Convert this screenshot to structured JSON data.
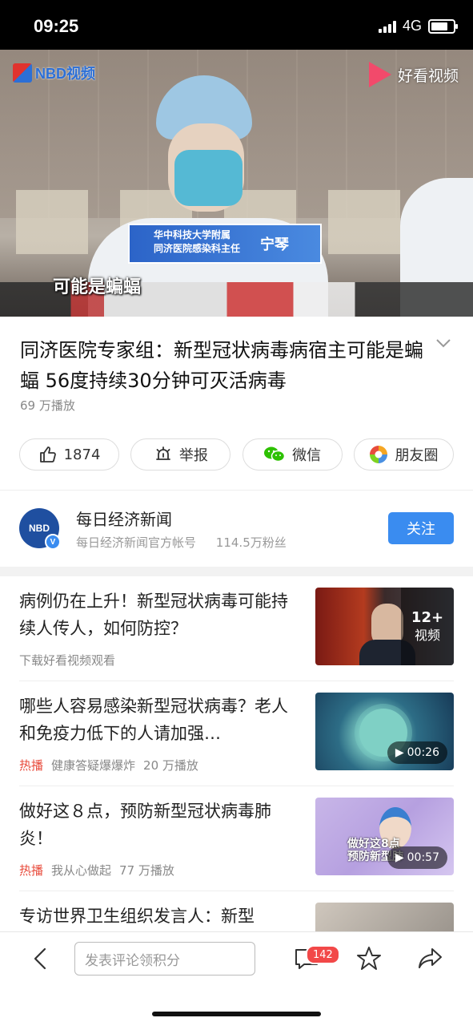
{
  "status_bar": {
    "time": "09:25",
    "network": "4G"
  },
  "video": {
    "source_logo": "NBD视频",
    "platform_logo": "好看视频",
    "caption_org_line1": "华中科技大学附属",
    "caption_org_line2": "同济医院感染科主任",
    "caption_name": "宁琴",
    "subtitle": "可能是蝙蝠"
  },
  "article": {
    "title": "同济医院专家组：新型冠状病毒病宿主可能是蝙蝠 56度持续30分钟可灭活病毒",
    "plays": "69 万播放",
    "actions": [
      {
        "label": "1874",
        "icon": "thumbs-up-icon"
      },
      {
        "label": "举报",
        "icon": "report-icon"
      },
      {
        "label": "微信",
        "icon": "wechat-icon"
      },
      {
        "label": "朋友圈",
        "icon": "moments-icon"
      }
    ]
  },
  "account": {
    "avatar_text": "NBD",
    "name": "每日经济新闻",
    "description": "每日经济新闻官方帐号",
    "followers": "114.5万粉丝",
    "follow_label": "关注"
  },
  "feed": [
    {
      "title": "病例仍在上升！新型冠状病毒可能持续人传人，如何防控？",
      "hot": "",
      "source": "下载好看视频观看",
      "plays": "",
      "overlay_count": "12+",
      "overlay_label": "视频",
      "duration": ""
    },
    {
      "title": "哪些人容易感染新型冠状病毒？老人和免疫力低下的人请加强…",
      "hot": "热播",
      "source": "健康答疑爆爆炸",
      "plays": "20 万播放",
      "duration": "00:26"
    },
    {
      "title": "做好这８点，预防新型冠状病毒肺炎！",
      "hot": "热播",
      "source": "我从心做起",
      "plays": "77 万播放",
      "duration": "00:57",
      "thumb_text_1": "做好这8点",
      "thumb_text_2": "预防新型肺"
    },
    {
      "title": "专访世界卫生组织发言人：新型"
    }
  ],
  "bottom_bar": {
    "comment_placeholder": "发表评论领积分",
    "comment_count": "142"
  },
  "colors": {
    "accent": "#3a8cf0",
    "hot": "#e84c3d",
    "badge": "#f24848"
  }
}
